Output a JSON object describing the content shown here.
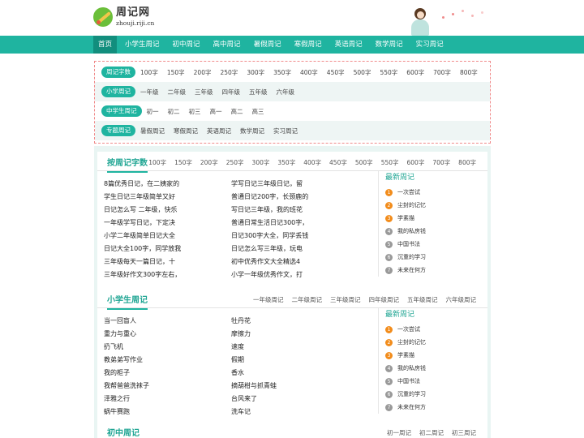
{
  "header": {
    "site_title": "周记网",
    "site_domain": "zhouji.riji.cn"
  },
  "nav": {
    "items": [
      "首页",
      "小学生周记",
      "初中周记",
      "高中周记",
      "暑假周记",
      "寒假周记",
      "英语周记",
      "数学周记",
      "实习周记"
    ]
  },
  "filter": {
    "rows": [
      {
        "label": "周记字数",
        "options": [
          "100字",
          "150字",
          "200字",
          "250字",
          "300字",
          "350字",
          "400字",
          "450字",
          "500字",
          "550字",
          "600字",
          "700字",
          "800字"
        ]
      },
      {
        "label": "小学周记",
        "options": [
          "一年级",
          "二年级",
          "三年级",
          "四年级",
          "五年级",
          "六年级"
        ]
      },
      {
        "label": "中学生周记",
        "options": [
          "初一",
          "初二",
          "初三",
          "高一",
          "高二",
          "高三"
        ]
      },
      {
        "label": "专题周记",
        "options": [
          "暑假周记",
          "寒假周记",
          "英语周记",
          "数学周记",
          "实习周记"
        ]
      }
    ]
  },
  "sections": {
    "wordcount": {
      "title": "按周记字数",
      "links": [
        "100字",
        "150字",
        "200字",
        "250字",
        "300字",
        "350字",
        "400字",
        "450字",
        "500字",
        "550字",
        "600字",
        "700字",
        "800字"
      ],
      "col1": [
        "8篇优秀日记，在二姨家的",
        "学生日记三年级简单又好",
        "日记怎么写 二年级，快乐",
        "一年级学写日记，下定决",
        "小学二年级简单日记大全",
        "日记大全100字，同学放我",
        "三年级每天一篇日记，十",
        "三年级好作文300字左右，"
      ],
      "col2": [
        "学写日记三年级日记，留",
        "普通日记200字，长颈鹿的",
        "写日记三年级，我的班花",
        "普通日常生活日记300字，",
        "日记300字大全，同学丢钱",
        "日记怎么写三年级，玩电",
        "初中优秀作文大全精选4",
        "小学一年级优秀作文，打"
      ],
      "side_title": "最新周记",
      "side": [
        "一次尝试",
        "尘封的记忆",
        "学素描",
        "我的私房钱",
        "中国书法",
        "沉重的学习",
        "未来在何方"
      ]
    },
    "primary": {
      "title": "小学生周记",
      "links": [
        "一年级周记",
        "二年级周记",
        "三年级周记",
        "四年级周记",
        "五年级周记",
        "六年级周记"
      ],
      "col1": [
        "当一回盲人",
        "重力与重心",
        "扔飞机",
        "教弟弟写作业",
        "我的柜子",
        "我帮爸爸洗袜子",
        "泽雅之行",
        "蜗牛赛跑"
      ],
      "col2": [
        "牡丹花",
        "摩擦力",
        "速度",
        "假期",
        "香水",
        "摘葫柑与抓青蛙",
        "台风来了",
        "洗车记"
      ],
      "side_title": "最新周记",
      "side": [
        "一次尝试",
        "尘封的记忆",
        "学素描",
        "我的私房钱",
        "中国书法",
        "沉重的学习",
        "未来在何方"
      ]
    },
    "junior": {
      "title": "初中周记",
      "links": [
        "初一周记",
        "初二周记",
        "初三周记"
      ]
    }
  },
  "colors": {
    "accent": "#1fb4a0",
    "hot": "#f28c1b",
    "dashed_border": "#f08a8a"
  }
}
